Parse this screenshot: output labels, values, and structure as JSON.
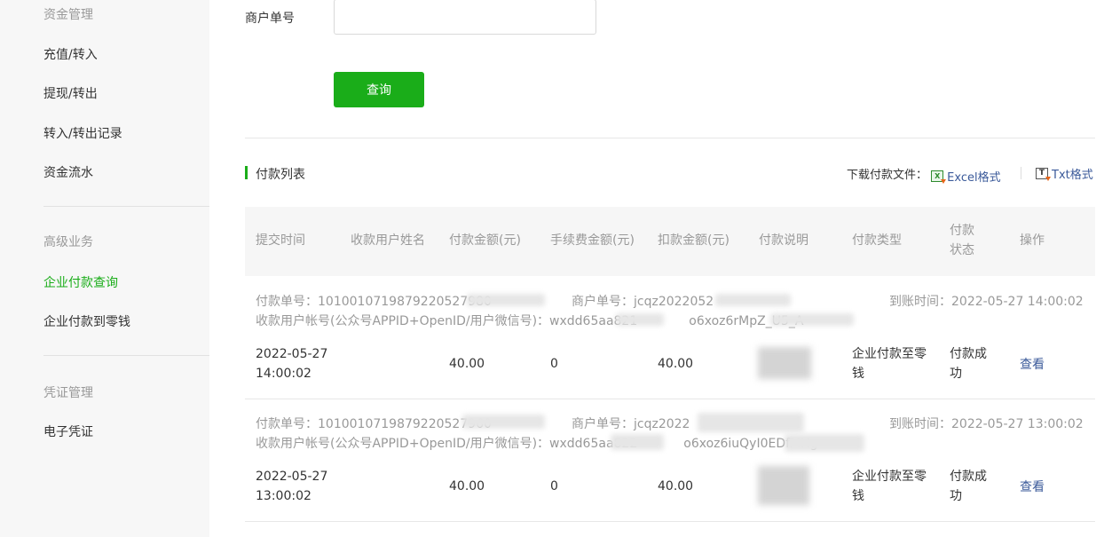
{
  "sidebar": {
    "groups": [
      {
        "title": "资金管理",
        "items": [
          "充值/转入",
          "提现/转出",
          "转入/转出记录",
          "资金流水"
        ]
      },
      {
        "title": "高级业务",
        "items": [
          "企业付款查询",
          "企业付款到零钱"
        ]
      },
      {
        "title": "凭证管理",
        "items": [
          "电子凭证"
        ]
      }
    ],
    "active_item": "企业付款查询"
  },
  "form": {
    "merchant_no_label": "商户单号",
    "merchant_no_value": "",
    "query_button": "查询"
  },
  "section": {
    "title": "付款列表",
    "download_label": "下载付款文件：",
    "excel_link": "Excel格式",
    "txt_link": "Txt格式"
  },
  "table": {
    "headers": [
      "提交时间",
      "收款用户姓名",
      "付款金额(元)",
      "手续费金额(元)",
      "扣款金额(元)",
      "付款说明",
      "付款类型",
      "付款状态",
      "操作"
    ],
    "rows": [
      {
        "pay_no_label": "付款单号：",
        "pay_no": "1010010719879220527980",
        "merchant_no_label": "商户单号：",
        "merchant_no": "jcqz2022052",
        "arrival_label": "到账时间：",
        "arrival_time": "2022-05-27 14:00:02",
        "account_label": "收款用户帐号(公众号APPID+OpenID/用户微信号)：",
        "account": "wxdd65aa821",
        "account_tail": "o6xoz6rMpZ_U5_A",
        "submit_date": "2022-05-27",
        "submit_time": "14:00:02",
        "name": "",
        "amount": "40.00",
        "fee": "0",
        "deduct": "40.00",
        "desc": "",
        "type": "企业付款至零钱",
        "status": "付款成功",
        "action": "查看"
      },
      {
        "pay_no_label": "付款单号：",
        "pay_no": "1010010719879220527960",
        "merchant_no_label": "商户单号：",
        "merchant_no": "jcqz2022",
        "arrival_label": "到账时间：",
        "arrival_time": "2022-05-27 13:00:02",
        "account_label": "收款用户帐号(公众号APPID+OpenID/用户微信号)：",
        "account": "wxdd65aa822",
        "account_tail": "o6xoz6iuQyI0EDfMHg",
        "submit_date": "2022-05-27",
        "submit_time": "13:00:02",
        "name": "",
        "amount": "40.00",
        "fee": "0",
        "deduct": "40.00",
        "desc": "",
        "type": "企业付款至零钱",
        "status": "付款成功",
        "action": "查看"
      }
    ]
  },
  "colors": {
    "accent": "#1aad19",
    "link": "#3b5a9a",
    "muted": "#999999",
    "sidebar_bg": "#f7f7f7"
  }
}
